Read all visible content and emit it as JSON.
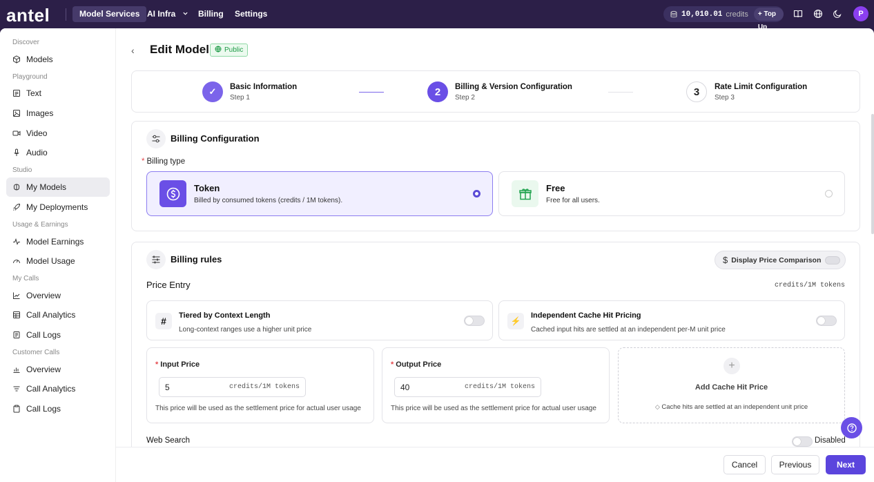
{
  "topbar": {
    "logo": "antel",
    "nav": [
      "Model Services",
      "AI Infra",
      "Billing",
      "Settings"
    ],
    "credits_value": "10,010.01",
    "credits_label": "credits",
    "topup_label": "+ Top Up",
    "avatar_initial": "P"
  },
  "sidebar": {
    "sections": [
      {
        "title": "Discover",
        "items": [
          "Models"
        ]
      },
      {
        "title": "Playground",
        "items": [
          "Text",
          "Images",
          "Video",
          "Audio"
        ]
      },
      {
        "title": "Studio",
        "items": [
          "My Models",
          "My Deployments"
        ]
      },
      {
        "title": "Usage & Earnings",
        "items": [
          "Model Earnings",
          "Model Usage"
        ]
      },
      {
        "title": "My Calls",
        "items": [
          "Overview",
          "Call Analytics",
          "Call Logs"
        ]
      },
      {
        "title": "Customer Calls",
        "items": [
          "Overview",
          "Call Analytics",
          "Call Logs"
        ]
      }
    ]
  },
  "page": {
    "back_glyph": "‹",
    "title": "Edit Model",
    "badge": "Public"
  },
  "stepper": {
    "steps": [
      {
        "num": "✓",
        "title": "Basic Information",
        "sub": "Step 1"
      },
      {
        "num": "2",
        "title": "Billing & Version Configuration",
        "sub": "Step 2"
      },
      {
        "num": "3",
        "title": "Rate Limit Configuration",
        "sub": "Step 3"
      }
    ]
  },
  "billing_config": {
    "title": "Billing Configuration",
    "type_label": "Billing type",
    "options": [
      {
        "title": "Token",
        "desc": "Billed by consumed tokens (credits / 1M tokens).",
        "selected": true
      },
      {
        "title": "Free",
        "desc": "Free for all users.",
        "selected": false
      }
    ]
  },
  "billing_rules": {
    "title": "Billing rules",
    "compare_label": "Display Price Comparison",
    "price_entry": "Price Entry",
    "unit": "credits/1M tokens",
    "features": [
      {
        "icon": "#",
        "title": "Tiered by Context Length",
        "desc": "Long-context ranges use a higher unit price"
      },
      {
        "icon": "⚡",
        "title": "Independent Cache Hit Pricing",
        "desc": "Cached input hits are settled at an independent per-M unit price"
      }
    ],
    "input_price": {
      "label": "Input Price",
      "value": "5",
      "unit": "credits/1M tokens",
      "help": "This price will be used as the settlement price for actual user usage"
    },
    "output_price": {
      "label": "Output Price",
      "value": "40",
      "unit": "credits/1M tokens",
      "help": "This price will be used as the settlement price for actual user usage"
    },
    "cache": {
      "plus": "+",
      "title": "Add Cache Hit Price",
      "desc": "Cache hits are settled at an independent unit price"
    },
    "web_search": {
      "label": "Web Search",
      "status": "Disabled"
    }
  },
  "footer": {
    "cancel": "Cancel",
    "previous": "Previous",
    "next": "Next"
  },
  "colors": {
    "brand": "#5b45dd",
    "topbar": "#2c1f48",
    "selected_bg": "#f1efff",
    "public_green": "#1c9a45"
  }
}
